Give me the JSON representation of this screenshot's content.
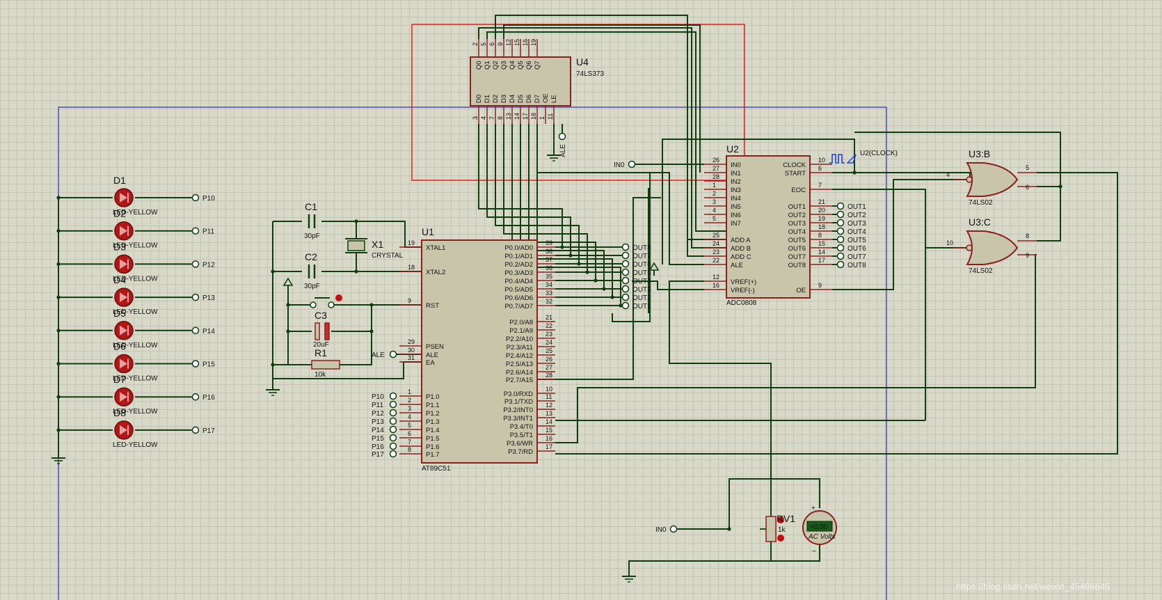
{
  "u4": {
    "ref": "U4",
    "part": "74LS373",
    "top_names": [
      "Q0",
      "Q1",
      "Q2",
      "Q3",
      "Q4",
      "Q5",
      "Q6",
      "Q7"
    ],
    "top_nums": [
      "2",
      "5",
      "6",
      "9",
      "12",
      "15",
      "16",
      "19"
    ],
    "bot_names": [
      "D0",
      "D1",
      "D2",
      "D3",
      "D4",
      "D5",
      "D6",
      "D7",
      "OE",
      "LE"
    ],
    "bot_nums": [
      "3",
      "4",
      "7",
      "8",
      "13",
      "14",
      "17",
      "18",
      "1",
      "11"
    ],
    "ale": "ALE"
  },
  "u1": {
    "ref": "U1",
    "part": "AT89C51",
    "left_pins": [
      {
        "num": "19",
        "name": "XTAL1"
      },
      {
        "num": "18",
        "name": "XTAL2"
      },
      {
        "num": "9",
        "name": "RST"
      },
      {
        "num": "29",
        "name": "PSEN"
      },
      {
        "num": "30",
        "name": "ALE"
      },
      {
        "num": "31",
        "name": "EA"
      },
      {
        "num": "1",
        "name": "P1.0"
      },
      {
        "num": "2",
        "name": "P1.1"
      },
      {
        "num": "3",
        "name": "P1.2"
      },
      {
        "num": "4",
        "name": "P1.3"
      },
      {
        "num": "5",
        "name": "P1.4"
      },
      {
        "num": "6",
        "name": "P1.5"
      },
      {
        "num": "7",
        "name": "P1.6"
      },
      {
        "num": "8",
        "name": "P1.7"
      }
    ],
    "right_pins": [
      {
        "num": "39",
        "name": "P0.0/AD0"
      },
      {
        "num": "38",
        "name": "P0.1/AD1"
      },
      {
        "num": "37",
        "name": "P0.2/AD2"
      },
      {
        "num": "36",
        "name": "P0.3/AD3"
      },
      {
        "num": "35",
        "name": "P0.4/AD4"
      },
      {
        "num": "34",
        "name": "P0.5/AD5"
      },
      {
        "num": "33",
        "name": "P0.6/AD6"
      },
      {
        "num": "32",
        "name": "P0.7/AD7"
      },
      {
        "num": "21",
        "name": "P2.0/A8"
      },
      {
        "num": "22",
        "name": "P2.1/A9"
      },
      {
        "num": "23",
        "name": "P2.2/A10"
      },
      {
        "num": "24",
        "name": "P2.3/A11"
      },
      {
        "num": "25",
        "name": "P2.4/A12"
      },
      {
        "num": "26",
        "name": "P2.5/A13"
      },
      {
        "num": "27",
        "name": "P2.6/A14"
      },
      {
        "num": "28",
        "name": "P2.7/A15"
      },
      {
        "num": "10",
        "name": "P3.0/RXD"
      },
      {
        "num": "11",
        "name": "P3.1/TXD"
      },
      {
        "num": "12",
        "name": "P3.2/INT0"
      },
      {
        "num": "13",
        "name": "P3.3/INT1"
      },
      {
        "num": "14",
        "name": "P3.4/T0"
      },
      {
        "num": "15",
        "name": "P3.5/T1"
      },
      {
        "num": "16",
        "name": "P3.6/WR"
      },
      {
        "num": "17",
        "name": "P3.7/RD"
      }
    ],
    "p1_labels": [
      "P10",
      "P11",
      "P12",
      "P13",
      "P14",
      "P15",
      "P16",
      "P17"
    ],
    "ale_label": "ALE",
    "out_labels": [
      "OUT8",
      "OUT7",
      "OUT6",
      "OUT5",
      "OUT4",
      "OUT3",
      "OUT2",
      "OUT1"
    ]
  },
  "u2": {
    "ref": "U2",
    "part": "ADC0808",
    "left_pins": [
      {
        "num": "26",
        "name": "IN0"
      },
      {
        "num": "27",
        "name": "IN1"
      },
      {
        "num": "28",
        "name": "IN2"
      },
      {
        "num": "1",
        "name": "IN3"
      },
      {
        "num": "2",
        "name": "IN4"
      },
      {
        "num": "3",
        "name": "IN5"
      },
      {
        "num": "4",
        "name": "IN6"
      },
      {
        "num": "5",
        "name": "IN7"
      },
      {
        "num": "25",
        "name": "ADD A"
      },
      {
        "num": "24",
        "name": "ADD B"
      },
      {
        "num": "23",
        "name": "ADD C"
      },
      {
        "num": "22",
        "name": "ALE"
      },
      {
        "num": "12",
        "name": "VREF(+)"
      },
      {
        "num": "16",
        "name": "VREF(-)"
      }
    ],
    "right_pins": [
      {
        "num": "10",
        "name": "CLOCK"
      },
      {
        "num": "6",
        "name": "START"
      },
      {
        "num": "7",
        "name": "EOC"
      },
      {
        "num": "21",
        "name": "OUT1"
      },
      {
        "num": "20",
        "name": "OUT2"
      },
      {
        "num": "19",
        "name": "OUT3"
      },
      {
        "num": "18",
        "name": "OUT4"
      },
      {
        "num": "8",
        "name": "OUT5"
      },
      {
        "num": "15",
        "name": "OUT6"
      },
      {
        "num": "14",
        "name": "OUT7"
      },
      {
        "num": "17",
        "name": "OUT8"
      },
      {
        "num": "9",
        "name": "OE"
      }
    ],
    "out_labels": [
      "OUT1",
      "OUT2",
      "OUT3",
      "OUT4",
      "OUT5",
      "OUT6",
      "OUT7",
      "OUT8"
    ],
    "in0_label": "IN0",
    "clock_label": "U2(CLOCK)"
  },
  "u3b": {
    "ref": "U3:B",
    "part": "74LS02",
    "pins": [
      "4",
      "5",
      "6"
    ]
  },
  "u3c": {
    "ref": "U3:C",
    "part": "74LS02",
    "pins": [
      "10",
      "8",
      "9"
    ]
  },
  "c1": {
    "ref": "C1",
    "value": "30pF"
  },
  "c2": {
    "ref": "C2",
    "value": "30pF"
  },
  "c3": {
    "ref": "C3",
    "value": "20uF"
  },
  "r1": {
    "ref": "R1",
    "value": "10k"
  },
  "x1": {
    "ref": "X1",
    "value": "CRYSTAL"
  },
  "leds": [
    {
      "ref": "D1",
      "part": "LED-YELLOW",
      "net": "P10"
    },
    {
      "ref": "D2",
      "part": "LED-YELLOW",
      "net": "P11"
    },
    {
      "ref": "D3",
      "part": "LED-YELLOW",
      "net": "P12"
    },
    {
      "ref": "D4",
      "part": "LED-YELLOW",
      "net": "P13"
    },
    {
      "ref": "D5",
      "part": "LED-YELLOW",
      "net": "P14"
    },
    {
      "ref": "D6",
      "part": "LED-YELLOW",
      "net": "P15"
    },
    {
      "ref": "D7",
      "part": "LED-YELLOW",
      "net": "P16"
    },
    {
      "ref": "D8",
      "part": "LED-YELLOW",
      "net": "P17"
    }
  ],
  "rv1": {
    "ref": "RV1",
    "value": "1k",
    "in0": "IN0"
  },
  "voltmeter": {
    "display": "+0.00",
    "caption": "AC Volts"
  },
  "watermark": "https://blog.csdn.net/weixin_45486645",
  "colors": {
    "wire": "#0f3d0f",
    "part_outline": "#8a2020",
    "part_fill": "#c8c5ab",
    "selection": "#e02020",
    "sheet_border": "#3030c0",
    "probe": "#2040d0"
  }
}
